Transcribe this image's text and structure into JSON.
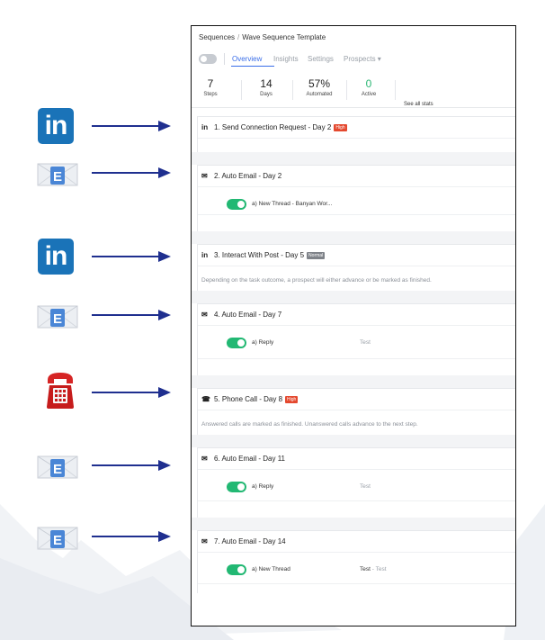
{
  "breadcrumb": {
    "root": "Sequences",
    "separator": "/",
    "current": "Wave Sequence Template"
  },
  "tabs": [
    {
      "label": "Overview",
      "active": true
    },
    {
      "label": "Insights",
      "active": false
    },
    {
      "label": "Settings",
      "active": false
    },
    {
      "label": "Prospects ▾",
      "active": false
    }
  ],
  "stats": [
    {
      "value": "7",
      "label": "Steps"
    },
    {
      "value": "14",
      "label": "Days"
    },
    {
      "value": "57%",
      "label": "Automated"
    },
    {
      "value": "0",
      "label": "Active"
    }
  ],
  "see_all_label": "See all stats",
  "steps": [
    {
      "icon": "linkedin-icon",
      "title": "1. Send Connection Request - Day 2",
      "badge": "High"
    },
    {
      "icon": "email-icon",
      "title": "2. Auto Email - Day 2",
      "variant": {
        "name": "a) New Thread - Banyan Wor...",
        "subject": ""
      }
    },
    {
      "icon": "linkedin-icon",
      "title": "3. Interact With Post - Day 5",
      "badge": "Normal",
      "description": "Depending on the task outcome, a prospect will either advance or be marked as finished."
    },
    {
      "icon": "email-icon",
      "title": "4. Auto Email - Day 7",
      "variant": {
        "name": "a) Reply",
        "subject": "Test"
      }
    },
    {
      "icon": "phone-icon",
      "title": "5. Phone Call - Day 8",
      "badge": "High",
      "description": "Answered calls are marked as finished. Unanswered calls advance to the next step."
    },
    {
      "icon": "email-icon",
      "title": "6. Auto Email - Day 11",
      "variant": {
        "name": "a) Reply",
        "subject": "Test"
      }
    },
    {
      "icon": "email-icon",
      "title": "7. Auto Email - Day 14",
      "variant": {
        "name": "a) New Thread",
        "subject": "Test",
        "subject_suffix": "- Test"
      }
    }
  ],
  "annotation_icons": [
    {
      "type": "linkedin-icon",
      "text": "in"
    },
    {
      "type": "email-icon",
      "text": "E"
    },
    {
      "type": "linkedin-icon",
      "text": "in"
    },
    {
      "type": "email-icon",
      "text": "E"
    },
    {
      "type": "phone-icon"
    },
    {
      "type": "email-icon",
      "text": "E"
    },
    {
      "type": "email-icon",
      "text": "E"
    }
  ],
  "colors": {
    "accent": "#3a6ee8",
    "toggle_on": "#22b873",
    "badge_high": "#e4492f",
    "badge_normal": "#7f8389",
    "arrow": "#1f2f8f",
    "linkedin": "#1a73b8",
    "phone": "#c61c1c"
  }
}
